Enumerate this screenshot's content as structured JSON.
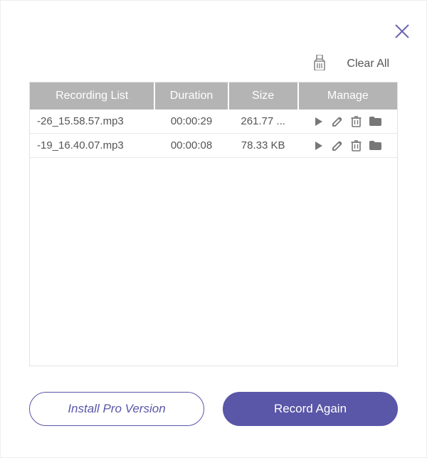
{
  "toolbar": {
    "clear_all_label": "Clear All"
  },
  "table": {
    "headers": {
      "name": "Recording List",
      "duration": "Duration",
      "size": "Size",
      "manage": "Manage"
    },
    "rows": [
      {
        "name": "-26_15.58.57.mp3",
        "duration": "00:00:29",
        "size": "261.77 ..."
      },
      {
        "name": "-19_16.40.07.mp3",
        "duration": "00:00:08",
        "size": "78.33 KB"
      }
    ]
  },
  "footer": {
    "install_pro_label": "Install Pro Version",
    "record_again_label": "Record Again"
  }
}
